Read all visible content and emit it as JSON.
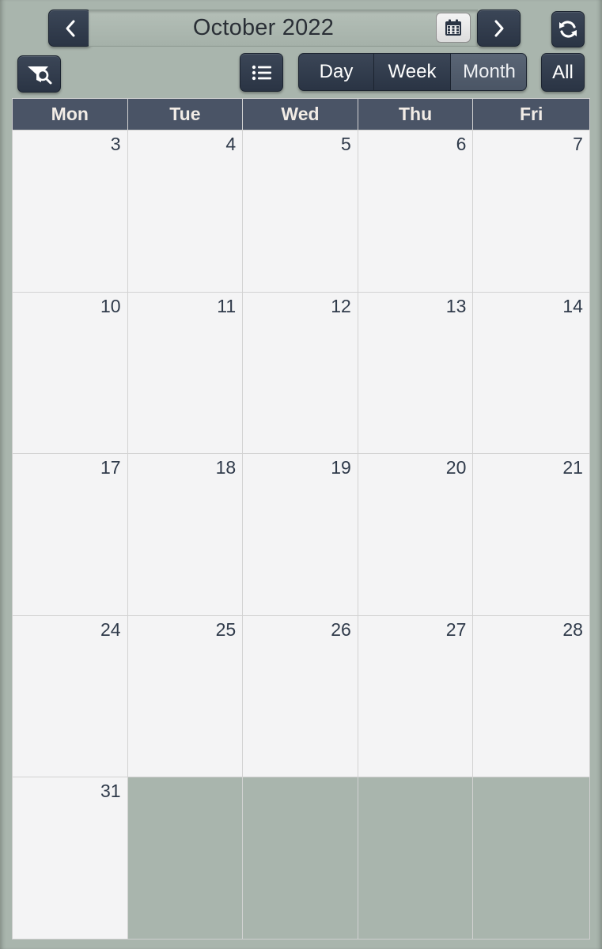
{
  "header": {
    "title": "October 2022",
    "prev_icon": "chevron-left-icon",
    "next_icon": "chevron-right-icon",
    "calendar_icon": "calendar-icon",
    "refresh_icon": "refresh-icon"
  },
  "toolbar": {
    "filter_icon": "filter-search-icon",
    "list_icon": "list-icon",
    "views": [
      "Day",
      "Week",
      "Month"
    ],
    "active_view": "Month",
    "all_label": "All"
  },
  "weekdays": [
    "Mon",
    "Tue",
    "Wed",
    "Thu",
    "Fri"
  ],
  "weeks": [
    [
      "3",
      "4",
      "5",
      "6",
      "7"
    ],
    [
      "10",
      "11",
      "12",
      "13",
      "14"
    ],
    [
      "17",
      "18",
      "19",
      "20",
      "21"
    ],
    [
      "24",
      "25",
      "26",
      "27",
      "28"
    ],
    [
      "31",
      "",
      "",
      "",
      ""
    ]
  ],
  "colors": {
    "background": "#a9b5ad",
    "button_dark": "#2f3a4a",
    "header_bg": "#4a5466",
    "cell_bg": "#f4f4f5"
  }
}
